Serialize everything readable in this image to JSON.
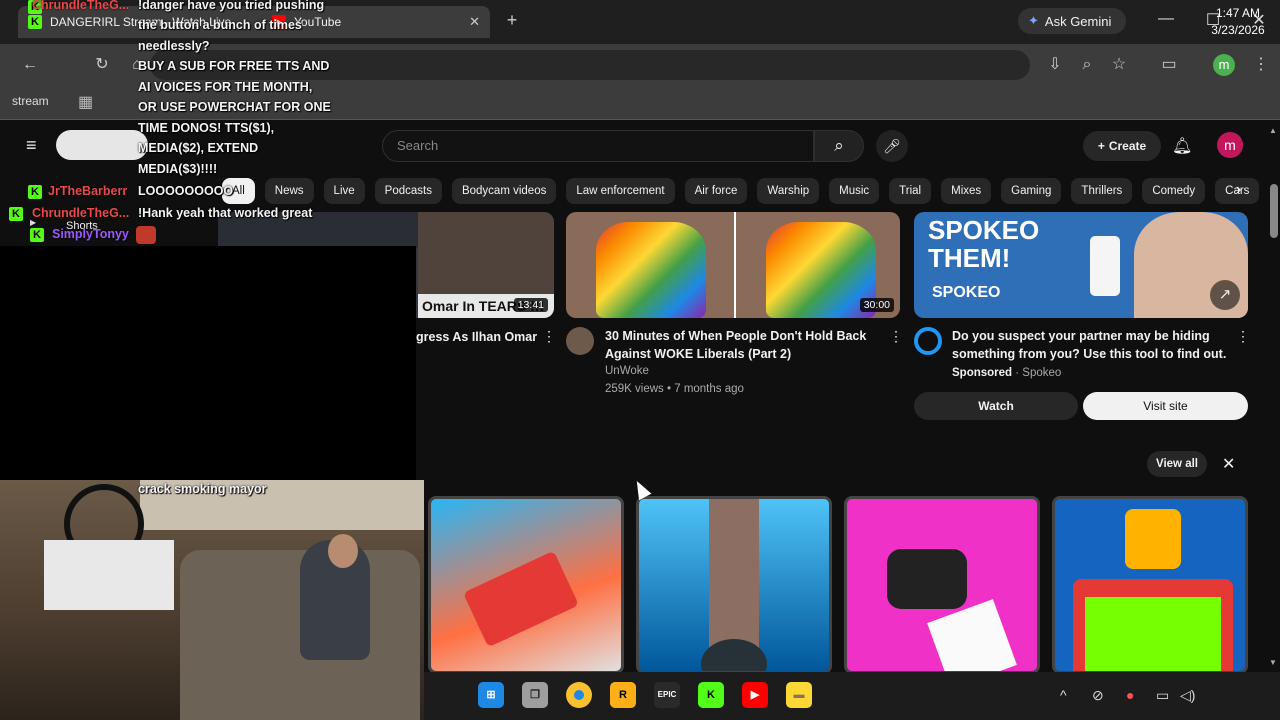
{
  "browser": {
    "tabs": [
      {
        "title": "DANGERIRL Stream - Watch Live",
        "close": "✕"
      },
      {
        "title": "YouTube"
      }
    ],
    "new_tab": "+",
    "gemini_label": "Ask Gemini",
    "window_controls": {
      "minimize": "—",
      "maximize": "☐",
      "close": "✕"
    },
    "profile_initial": "m",
    "bookmarks": {
      "item": "stream"
    }
  },
  "youtube": {
    "search_placeholder": "Search",
    "create_label": "Create",
    "avatar_initial": "m",
    "shorts_label": "Shorts",
    "chips": [
      "All",
      "News",
      "Live",
      "Podcasts",
      "Bodycam videos",
      "Law enforcement",
      "Air force",
      "Warship",
      "Music",
      "Trial",
      "Mixes",
      "Gaming",
      "Thrillers",
      "Comedy",
      "Cars"
    ],
    "videos": [
      {
        "thumb_text": "Omar In TEARS !!!",
        "duration": "13:41",
        "title": "gress As Ilhan Omar"
      },
      {
        "duration": "30:00",
        "title_line1": "30 Minutes of When People Don't Hold Back",
        "title_line2": "Against WOKE Liberals (Part 2)",
        "channel": "UnWoke",
        "meta": "259K views • 7 months ago"
      }
    ],
    "ad": {
      "headline_line1": "SPOKEO",
      "headline_line2": "THEM!",
      "brand": "SPOKEO",
      "title_line1": "Do you suspect your partner may be hiding",
      "title_line2": "something from you? Use this tool to find out.",
      "sponsored": "Sponsored",
      "advertiser": "· Spokeo",
      "watch_label": "Watch",
      "visit_label": "Visit site"
    },
    "shelf": {
      "view_all": "View all"
    }
  },
  "chat": {
    "messages": [
      {
        "user": "ChrundleTheG...",
        "user_color": "#e64a4a",
        "text_lines": [
          "!danger have you tried pushing",
          "the button a bunch of times",
          "needlessly?",
          "BUY A SUB FOR FREE TTS AND",
          "AI VOICES FOR THE MONTH,",
          "OR USE POWERCHAT FOR ONE",
          "TIME DONOS! TTS($1),",
          "MEDIA($2), EXTEND",
          "MEDIA($3)!!!!"
        ]
      },
      {
        "user": "JrTheBarberr",
        "user_color": "#e64a4a",
        "text": "LOOOOOOOOO"
      },
      {
        "user": "ChrundleTheG...",
        "user_color": "#e64a4a",
        "text": "!Hank yeah that worked great"
      },
      {
        "user": "SimplyTonyy",
        "user_color": "#9b59ff",
        "text": ""
      },
      {
        "text": "crack smoking mayor"
      }
    ]
  },
  "taskbar": {
    "time": "1:47 AM",
    "date": "3/23/2026",
    "apps": [
      "windows-start",
      "task-view",
      "chrome",
      "rockstar",
      "epic-games",
      "kick",
      "youtube",
      "file-explorer"
    ]
  },
  "colors": {
    "youtube_bg": "#0f0f0f",
    "chip_bg": "#272727",
    "kick_green": "#53fc18",
    "yt_red": "#ff0000"
  }
}
